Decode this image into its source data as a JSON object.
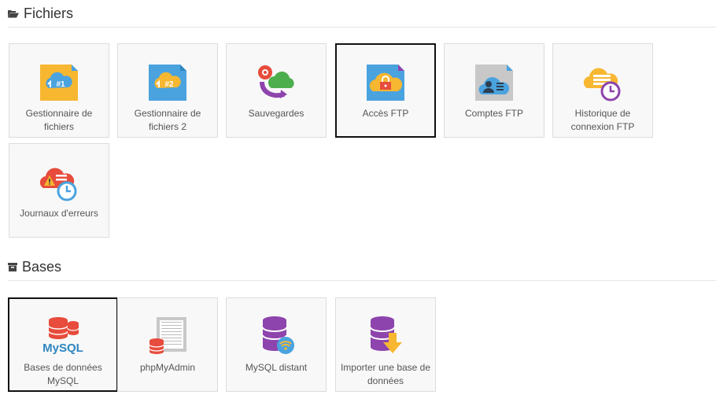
{
  "sections": [
    {
      "title": "Fichiers",
      "icon": "folder-open-icon"
    },
    {
      "title": "Bases",
      "icon": "archive-icon"
    }
  ],
  "files_tiles": [
    {
      "label": "Gestionnaire de fichiers",
      "icon": "file-manager-icon"
    },
    {
      "label": "Gestionnaire de fichiers 2",
      "icon": "file-manager-2-icon"
    },
    {
      "label": "Sauvegardes",
      "icon": "backup-icon"
    },
    {
      "label": "Accès FTP",
      "icon": "ftp-access-icon"
    },
    {
      "label": "Comptes FTP",
      "icon": "ftp-accounts-icon"
    },
    {
      "label": "Historique de connexion FTP",
      "icon": "ftp-history-icon"
    },
    {
      "label": "Journaux d'erreurs",
      "icon": "error-logs-icon"
    }
  ],
  "db_tiles": [
    {
      "label": "Bases de données MySQL",
      "icon": "mysql-icon"
    },
    {
      "label": "phpMyAdmin",
      "icon": "phpmyadmin-icon"
    },
    {
      "label": "MySQL distant",
      "icon": "remote-mysql-icon"
    },
    {
      "label": "Importer une base de données",
      "icon": "import-database-icon"
    }
  ],
  "icon_text": {
    "fm1": "#1",
    "fm2": "#2",
    "mysql": "MySQL"
  },
  "colors": {
    "yellow": "#f7b731",
    "blue": "#4aa3df",
    "red": "#e74c3c",
    "purple": "#8e44ad",
    "green": "#4cae4c",
    "grey": "#c8c8c8"
  }
}
